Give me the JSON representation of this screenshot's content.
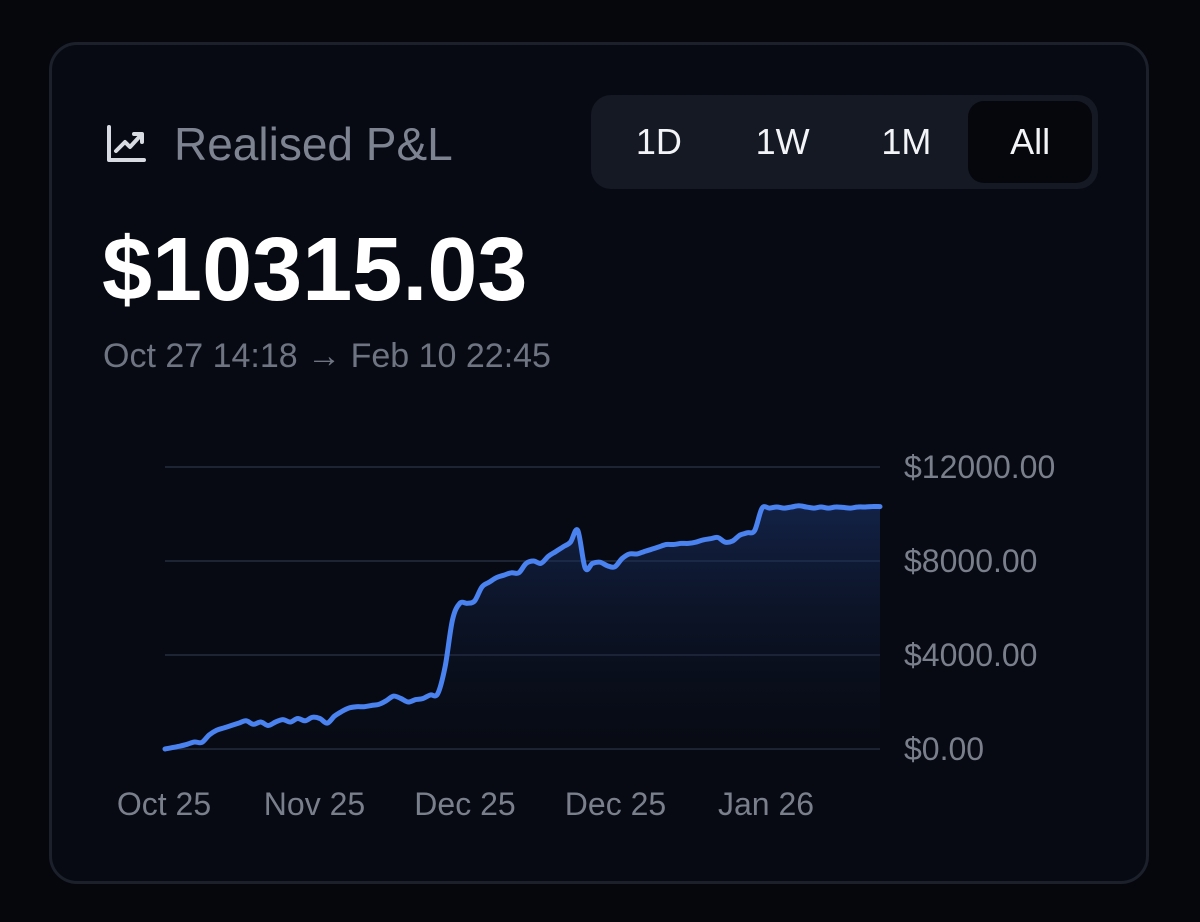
{
  "header": {
    "icon": "trending-up-chart-icon",
    "title": "Realised P&L"
  },
  "range_tabs": [
    {
      "label": "1D",
      "active": false
    },
    {
      "label": "1W",
      "active": false
    },
    {
      "label": "1M",
      "active": false
    },
    {
      "label": "All",
      "active": true
    }
  ],
  "summary": {
    "value": "$10315.03",
    "period": "Oct 27 14:18 → Feb 10 22:45"
  },
  "colors": {
    "line": "#4a82f0",
    "area_top": "#1c3570",
    "grid": "#1d2433",
    "background": "#070a12"
  },
  "chart_data": {
    "type": "area",
    "title": "",
    "xlabel": "",
    "ylabel": "",
    "ylim": [
      0,
      12000
    ],
    "y_ticks": [
      {
        "value": 12000,
        "label": "$12000.00"
      },
      {
        "value": 8000,
        "label": "$8000.00"
      },
      {
        "value": 4000,
        "label": "$4000.00"
      },
      {
        "value": 0,
        "label": "$0.00"
      }
    ],
    "x_tick_labels": [
      "Oct 25",
      "Nov 25",
      "Dec 25",
      "Dec 25",
      "Jan 26"
    ],
    "grid": true,
    "series": [
      {
        "values": [
          0,
          60,
          120,
          200,
          300,
          280,
          600,
          800,
          900,
          1000,
          1100,
          1200,
          1050,
          1150,
          1000,
          1150,
          1250,
          1150,
          1300,
          1200,
          1350,
          1300,
          1100,
          1400,
          1600,
          1750,
          1800,
          1800,
          1850,
          1900,
          2050,
          2250,
          2150,
          2000,
          2100,
          2150,
          2300,
          2350,
          3500,
          5500,
          6200,
          6200,
          6300,
          6900,
          7100,
          7300,
          7400,
          7500,
          7500,
          7900,
          8000,
          7900,
          8200,
          8400,
          8600,
          8800,
          9300,
          7700,
          7900,
          7950,
          7800,
          7750,
          8100,
          8300,
          8300,
          8400,
          8500,
          8600,
          8700,
          8700,
          8750,
          8750,
          8800,
          8900,
          8950,
          9000,
          8800,
          8850,
          9100,
          9200,
          9300,
          10250,
          10250,
          10300,
          10250,
          10300,
          10350,
          10300,
          10250,
          10300,
          10250,
          10300,
          10280,
          10250,
          10300,
          10300,
          10320,
          10315
        ]
      }
    ]
  }
}
